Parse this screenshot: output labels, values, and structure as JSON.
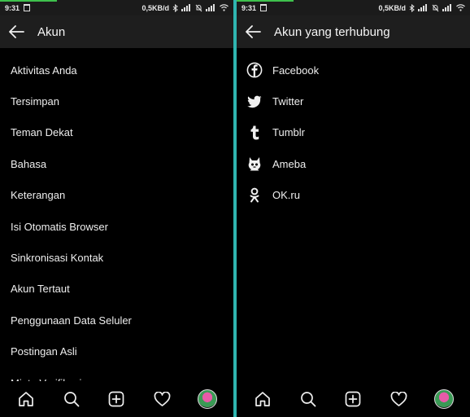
{
  "status": {
    "time": "9:31",
    "speed": "0,5KB/d"
  },
  "left": {
    "title": "Akun",
    "items": [
      "Aktivitas Anda",
      "Tersimpan",
      "Teman Dekat",
      "Bahasa",
      "Keterangan",
      "Isi Otomatis Browser",
      "Sinkronisasi Kontak",
      "Akun Tertaut",
      "Penggunaan Data Seluler",
      "Postingan Asli",
      "Minta Verifikasi"
    ]
  },
  "right": {
    "title": "Akun yang terhubung",
    "items": [
      {
        "label": "Facebook",
        "icon": "facebook-icon"
      },
      {
        "label": "Twitter",
        "icon": "twitter-icon"
      },
      {
        "label": "Tumblr",
        "icon": "tumblr-icon"
      },
      {
        "label": "Ameba",
        "icon": "ameba-icon"
      },
      {
        "label": "OK.ru",
        "icon": "okru-icon"
      }
    ]
  },
  "nav": [
    "home-icon",
    "search-icon",
    "add-post-icon",
    "activity-heart-icon",
    "profile-avatar"
  ],
  "colors": {
    "divider": "#2fb5b0",
    "status_green": "#3ec14d",
    "background": "#000000",
    "topbar": "#1e1e1e"
  }
}
